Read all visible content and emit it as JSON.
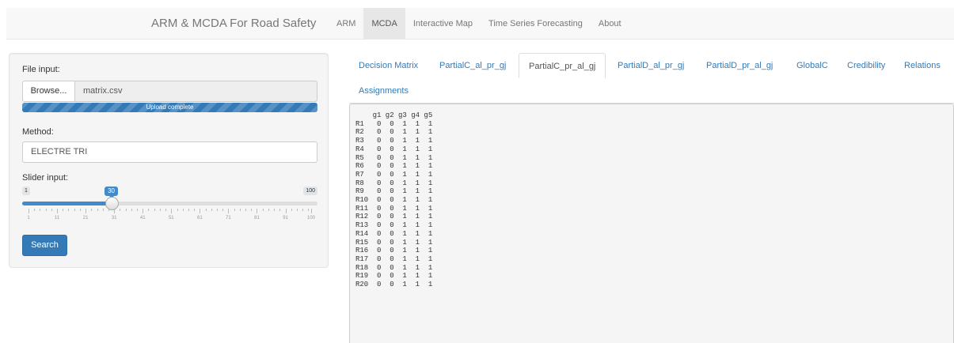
{
  "navbar": {
    "brand": "ARM & MCDA For Road Safety",
    "items": [
      {
        "label": "ARM",
        "active": false
      },
      {
        "label": "MCDA",
        "active": true
      },
      {
        "label": "Interactive Map",
        "active": false
      },
      {
        "label": "Time Series Forecasting",
        "active": false
      },
      {
        "label": "About",
        "active": false
      }
    ]
  },
  "sidebar": {
    "file_input_label": "File input:",
    "browse_label": "Browse...",
    "file_name": "matrix.csv",
    "upload_status": "Upload complete",
    "upload_progress": 1.0,
    "method_label": "Method:",
    "method_value": "ELECTRE TRI",
    "slider_label": "Slider input:",
    "slider": {
      "min": 1,
      "max": 100,
      "value": 30,
      "min_label": "1",
      "max_label": "100",
      "value_label": "30",
      "tick_labels": [
        "1",
        "11",
        "21",
        "31",
        "41",
        "51",
        "61",
        "71",
        "81",
        "91",
        "100"
      ]
    },
    "search_label": "Search"
  },
  "tabs": [
    {
      "label": "Decision Matrix",
      "active": false
    },
    {
      "label": "PartialC_al_pr_gj",
      "active": false
    },
    {
      "label": "PartialC_pr_al_gj",
      "active": true
    },
    {
      "label": "PartialD_al_pr_gj",
      "active": false
    },
    {
      "label": "PartialD_pr_al_gj",
      "active": false
    },
    {
      "label": "GlobalC",
      "active": false
    },
    {
      "label": "Credibility",
      "active": false
    },
    {
      "label": "Relations",
      "active": false
    },
    {
      "label": "Assignments",
      "active": false
    }
  ],
  "output": {
    "header": "    g1 g2 g3 g4 g5",
    "rows": [
      {
        "name": "R1",
        "values": [
          0,
          0,
          1,
          1,
          1
        ]
      },
      {
        "name": "R2",
        "values": [
          0,
          0,
          1,
          1,
          1
        ]
      },
      {
        "name": "R3",
        "values": [
          0,
          0,
          1,
          1,
          1
        ]
      },
      {
        "name": "R4",
        "values": [
          0,
          0,
          1,
          1,
          1
        ]
      },
      {
        "name": "R5",
        "values": [
          0,
          0,
          1,
          1,
          1
        ]
      },
      {
        "name": "R6",
        "values": [
          0,
          0,
          1,
          1,
          1
        ]
      },
      {
        "name": "R7",
        "values": [
          0,
          0,
          1,
          1,
          1
        ]
      },
      {
        "name": "R8",
        "values": [
          0,
          0,
          1,
          1,
          1
        ]
      },
      {
        "name": "R9",
        "values": [
          0,
          0,
          1,
          1,
          1
        ]
      },
      {
        "name": "R10",
        "values": [
          0,
          0,
          1,
          1,
          1
        ]
      },
      {
        "name": "R11",
        "values": [
          0,
          0,
          1,
          1,
          1
        ]
      },
      {
        "name": "R12",
        "values": [
          0,
          0,
          1,
          1,
          1
        ]
      },
      {
        "name": "R13",
        "values": [
          0,
          0,
          1,
          1,
          1
        ]
      },
      {
        "name": "R14",
        "values": [
          0,
          0,
          1,
          1,
          1
        ]
      },
      {
        "name": "R15",
        "values": [
          0,
          0,
          1,
          1,
          1
        ]
      },
      {
        "name": "R16",
        "values": [
          0,
          0,
          1,
          1,
          1
        ]
      },
      {
        "name": "R17",
        "values": [
          0,
          0,
          1,
          1,
          1
        ]
      },
      {
        "name": "R18",
        "values": [
          0,
          0,
          1,
          1,
          1
        ]
      },
      {
        "name": "R19",
        "values": [
          0,
          0,
          1,
          1,
          1
        ]
      },
      {
        "name": "R20",
        "values": [
          0,
          0,
          1,
          1,
          1
        ]
      }
    ]
  },
  "colors": {
    "primary": "#337ab7",
    "slider_accent": "#428bca",
    "navbar_bg": "#f8f8f8",
    "sidebar_bg": "#f5f5f5"
  }
}
